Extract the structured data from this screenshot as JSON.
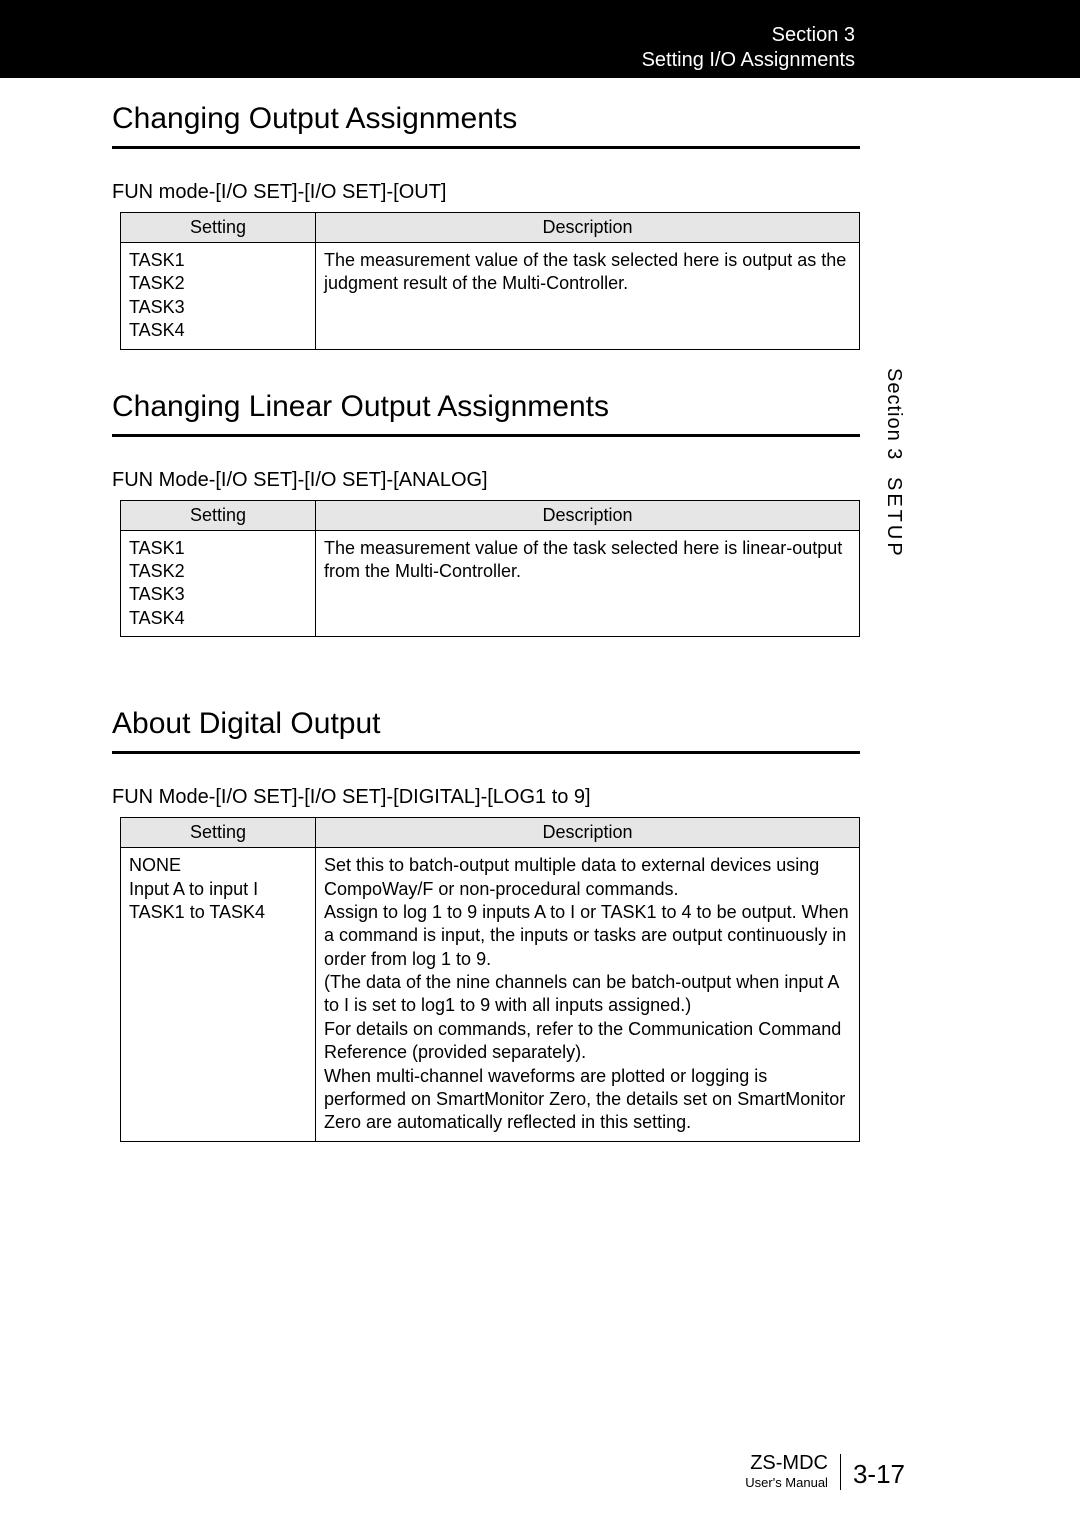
{
  "header": {
    "line1": "Section 3",
    "line2": "Setting I/O Assignments"
  },
  "sidetab": {
    "section": "Section 3",
    "setup": "SETUP"
  },
  "sections": [
    {
      "title": "Changing Output Assignments",
      "path": "FUN mode-[I/O SET]-[I/O SET]-[OUT]",
      "table": {
        "head_setting": "Setting",
        "head_desc": "Description",
        "setting": "TASK1\nTASK2\nTASK3\nTASK4",
        "desc": "The measurement value of the task selected here is output as the judgment result of the Multi-Controller."
      }
    },
    {
      "title": "Changing Linear Output Assignments",
      "path": "FUN Mode-[I/O SET]-[I/O SET]-[ANALOG]",
      "table": {
        "head_setting": "Setting",
        "head_desc": "Description",
        "setting": "TASK1\nTASK2\nTASK3\nTASK4",
        "desc": "The measurement value of the task selected here is linear-output from the Multi-Controller."
      }
    },
    {
      "title": "About Digital Output",
      "path": "FUN Mode-[I/O SET]-[I/O SET]-[DIGITAL]-[LOG1 to 9]",
      "table": {
        "head_setting": "Setting",
        "head_desc": "Description",
        "setting": "NONE\nInput A to input I\nTASK1 to TASK4",
        "desc": "Set this to batch-output multiple data to external devices using CompoWay/F or non-procedural commands.\nAssign to log 1 to 9 inputs A to I or TASK1 to 4 to be output. When a command is input, the inputs or tasks are output continuously in order from log 1 to 9.\n(The data of the nine channels can be batch-output when input A to I is set to log1 to 9 with all inputs  assigned.)\nFor details on commands, refer to the  Communication Command Reference (provided separately).\nWhen multi-channel waveforms are plotted or logging is performed on SmartMonitor Zero, the details set on SmartMonitor Zero are automatically reflected in this setting."
      }
    }
  ],
  "footer": {
    "product": "ZS-MDC",
    "manual": "User's Manual",
    "page": "3-17"
  }
}
